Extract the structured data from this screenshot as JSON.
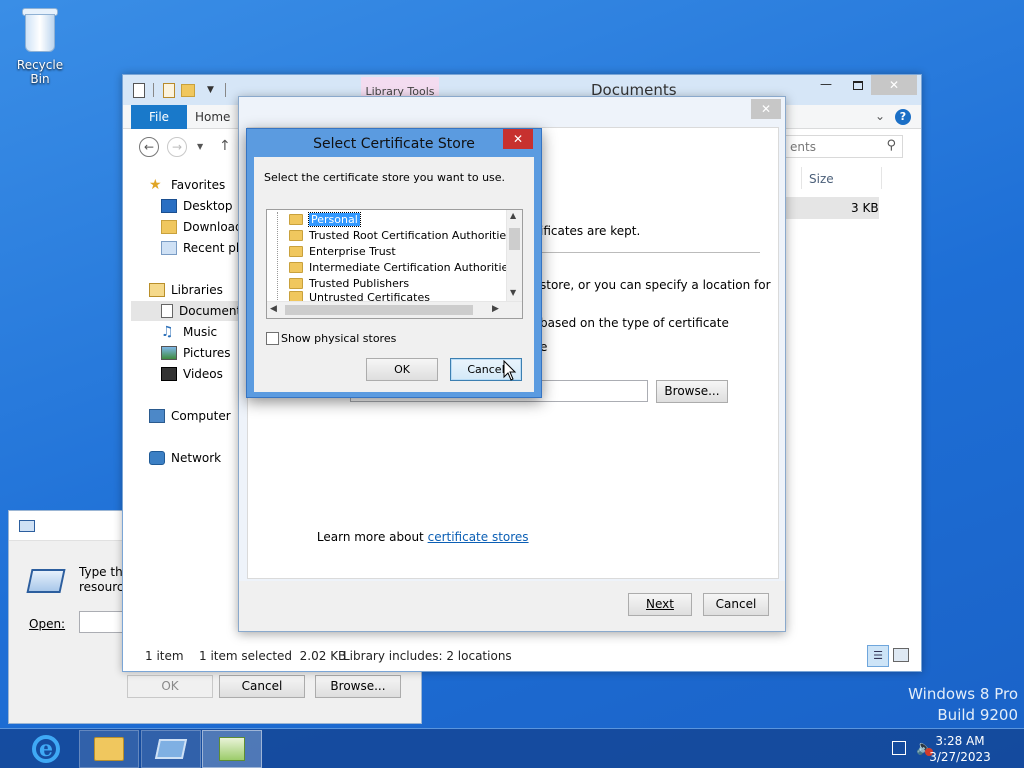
{
  "desktop": {
    "recycle_bin_label": "Recycle Bin",
    "watermark_line1": "Windows 8 Pro",
    "watermark_line2": "Build 9200"
  },
  "taskbar": {
    "items": [
      "internet-explorer-icon",
      "file-explorer-icon",
      "run-icon",
      "certificate-wizard-icon"
    ],
    "clock_time": "3:28 AM",
    "clock_date": "3/27/2023"
  },
  "run_dialog": {
    "prompt": "Type the name of a program, folder, document, or Internet resource",
    "prompt_visible_line1": "Type the",
    "prompt_visible_line2": "resource",
    "open_label": "Open:",
    "ok_label": "OK",
    "cancel_label": "Cancel",
    "browse_label": "Browse..."
  },
  "explorer": {
    "title": "Documents",
    "contextual_tab": "Library Tools",
    "tabs": [
      "File",
      "Home"
    ],
    "search_placeholder_fragment": "ents",
    "column_size": "Size",
    "row_size": "3 KB",
    "nav": {
      "favorites": "Favorites",
      "desktop": "Desktop",
      "downloads": "Downloads",
      "recent": "Recent plac",
      "libraries": "Libraries",
      "documents": "Document",
      "music": "Music",
      "pictures": "Pictures",
      "videos": "Videos",
      "computer": "Computer",
      "network": "Network"
    },
    "status": {
      "items": "1 item",
      "selected": "1 item selected  2.02 KB",
      "library": "Library includes: 2 locations"
    }
  },
  "wizard": {
    "text1": "ificates are kept.",
    "text2_line1": "store, or you can specify a location for",
    "text3": "based on the type of certificate",
    "text4": "e",
    "browse_label": "Browse...",
    "learn_more": "Learn more about ",
    "learn_more_link": "certificate stores",
    "next_label": "Next",
    "cancel_label": "Cancel"
  },
  "cert_store_dialog": {
    "title": "Select Certificate Store",
    "instruction": "Select the certificate store you want to use.",
    "stores": [
      "Personal",
      "Trusted Root Certification Authorities",
      "Enterprise Trust",
      "Intermediate Certification Authorities",
      "Trusted Publishers",
      "Untrusted Certificates"
    ],
    "selected_store": "Personal",
    "show_physical_label": "Show physical stores",
    "show_physical_checked": false,
    "ok_label": "OK",
    "cancel_label": "Cancel"
  }
}
